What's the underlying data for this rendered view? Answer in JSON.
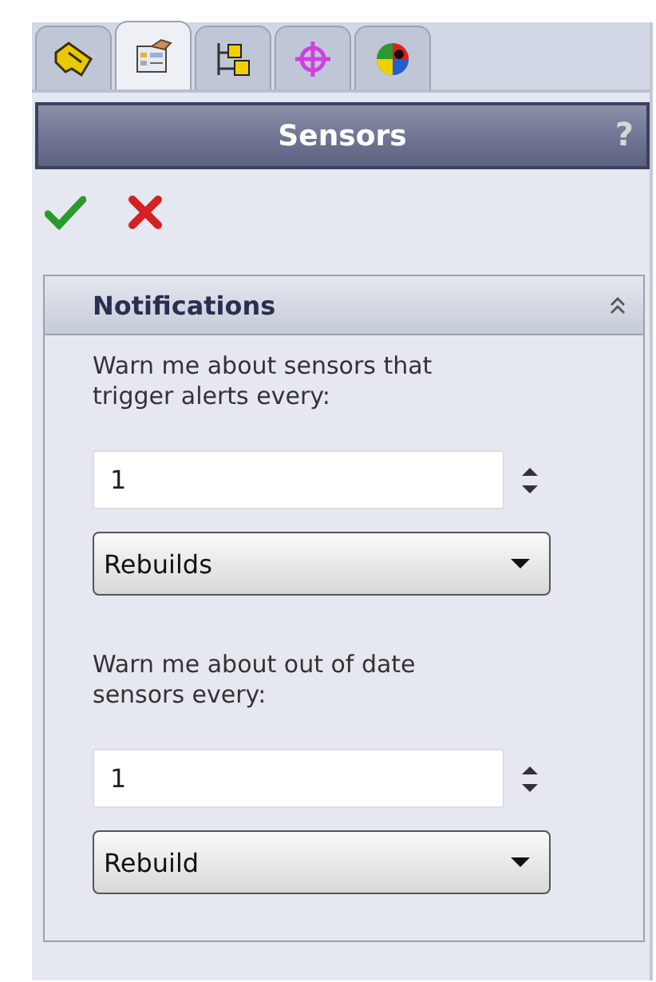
{
  "tabs": [
    {
      "kind": "part",
      "selected": false
    },
    {
      "kind": "property",
      "selected": true
    },
    {
      "kind": "config",
      "selected": false
    },
    {
      "kind": "target",
      "selected": false
    },
    {
      "kind": "appearance",
      "selected": false
    }
  ],
  "title_bar": {
    "title": "Sensors",
    "help": "?"
  },
  "group": {
    "title": "Notifications",
    "expanded": true,
    "settings": [
      {
        "label": "Warn me about sensors that trigger alerts every:",
        "value": "1",
        "unit": "Rebuilds"
      },
      {
        "label": "Warn me about out of date sensors every:",
        "value": "1",
        "unit": "Rebuild"
      }
    ]
  }
}
